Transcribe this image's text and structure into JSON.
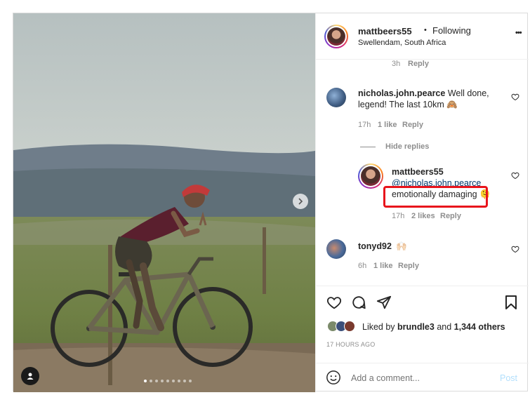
{
  "post": {
    "username": "mattbeers55",
    "separator": "•",
    "follow_status": "Following",
    "location": "Swellendam, South Africa",
    "more_label": "•••",
    "photo_count": 9,
    "active_photo": 1
  },
  "comments": {
    "prev_reply_time": "3h",
    "prev_reply_label": "Reply",
    "first": {
      "username": "nicholas.john.pearce",
      "text_line1": "Well done,",
      "text_line2": "legend! The last 10km 🙈",
      "time": "17h",
      "likes": "1 like",
      "reply_label": "Reply"
    },
    "hide_replies_label": "Hide replies",
    "reply": {
      "username": "mattbeers55",
      "mention": "@nicholas.john.pearce",
      "text": "emotionally damaging 🫠",
      "time": "17h",
      "likes": "2 likes",
      "reply_label": "Reply"
    },
    "second": {
      "username": "tonyd92",
      "text": "🙌🏻",
      "time": "6h",
      "likes": "1 like",
      "reply_label": "Reply"
    }
  },
  "likes": {
    "prefix": "Liked by",
    "user": "brundle3",
    "joiner": "and",
    "others": "1,344 others"
  },
  "timestamp": "17 HOURS AGO",
  "add_comment": {
    "placeholder": "Add a comment...",
    "post_label": "Post"
  },
  "colors": {
    "annotation_red": "#e8141c",
    "post_button_blue": "#b2dffc",
    "muted_text": "#8e8e8e"
  }
}
